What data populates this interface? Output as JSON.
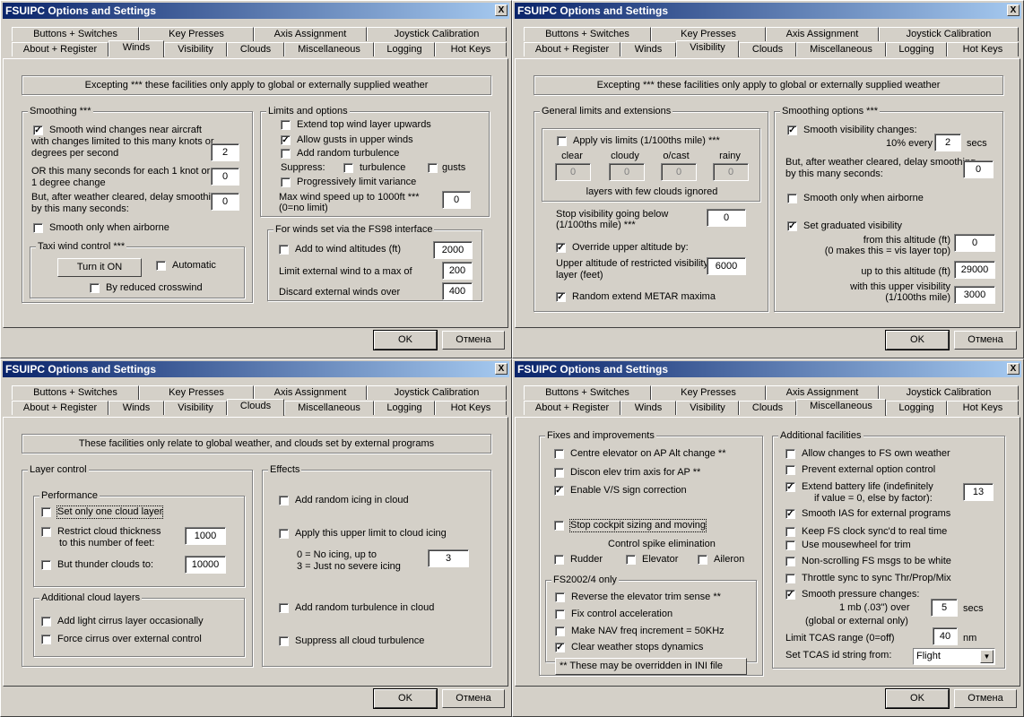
{
  "title": "FSUIPC Options and Settings",
  "close_glyph": "X",
  "tabs": {
    "row1": [
      "Buttons + Switches",
      "Key Presses",
      "Axis Assignment",
      "Joystick Calibration"
    ],
    "row2": [
      "About + Register",
      "Winds",
      "Visibility",
      "Clouds",
      "Miscellaneous",
      "Logging",
      "Hot Keys"
    ]
  },
  "buttons": {
    "ok": "OK",
    "cancel": "Отмена"
  },
  "winds": {
    "banner": "Excepting *** these facilities only apply to global or externally supplied weather",
    "smoothing": {
      "label": "Smoothing ***",
      "smooth_wind_l1": "Smooth wind changes near aircraft",
      "smooth_wind_l2": "with changes limited to this many knots or",
      "smooth_wind_l3": "degrees per second",
      "knots_value": "2",
      "or_seconds_l1": "OR this many seconds for each 1 knot or",
      "or_seconds_l2": "1 degree change",
      "seconds_value": "0",
      "delay_l1": "But, after weather cleared, delay smoothing",
      "delay_l2": "by this many seconds:",
      "delay_value": "0",
      "airborne": "Smooth only when airborne"
    },
    "taxi": {
      "label": "Taxi wind control ***",
      "turn_on": "Turn it ON",
      "automatic": "Automatic",
      "reduced": "By reduced crosswind"
    },
    "limits": {
      "label": "Limits and options",
      "extend_top": "Extend top wind layer upwards",
      "allow_gusts": "Allow gusts in upper winds",
      "add_turb": "Add random turbulence",
      "suppress": "Suppress:",
      "turbulence": "turbulence",
      "gusts": "gusts",
      "prog_limit": "Progressively limit variance",
      "max_speed_l1": "Max wind speed up to 1000ft  ***",
      "max_speed_l2": "(0=no limit)",
      "max_speed_value": "0"
    },
    "fs98": {
      "label": "For winds set via the FS98 interface",
      "add_alt": "Add to wind altitudes (ft)",
      "add_alt_value": "2000",
      "limit_ext": "Limit external wind to a max of",
      "limit_ext_value": "200",
      "discard": "Discard  external winds over",
      "discard_value": "400"
    }
  },
  "visibility": {
    "banner": "Excepting *** these facilities only apply to global or externally supplied weather",
    "general": {
      "label": "General limits and extensions",
      "apply_vis": "Apply vis limits (1/100ths mile)  ***",
      "cols": [
        "clear",
        "cloudy",
        "o/cast",
        "rainy"
      ],
      "values": [
        "0",
        "0",
        "0",
        "0"
      ],
      "few_clouds": "layers with few clouds ignored",
      "stop_l1": "Stop visibility going below",
      "stop_l2": "(1/100ths mile) ***",
      "stop_value": "0",
      "override": "Override upper altitude by:",
      "upper_l1": "Upper altitude of restricted visibility",
      "upper_l2": "layer (feet)",
      "upper_value": "6000",
      "random_metar": "Random extend METAR maxima"
    },
    "smoothing": {
      "label": "Smoothing options ***",
      "smooth_vis": "Smooth visibility changes:",
      "pct_every": "10% every",
      "every_value": "2",
      "secs": "secs",
      "delay_l1": "But, after weather cleared, delay smoothing",
      "delay_l2": "by this many seconds:",
      "delay_value": "0",
      "airborne": "Smooth only when airborne",
      "graduated": "Set graduated visibility",
      "from_l1": "from this altitude (ft)",
      "from_l2": "(0 makes this = vis layer top)",
      "from_value": "0",
      "upto": "up to this altitude (ft)",
      "upto_value": "29000",
      "upper_l1": "with this upper visibility",
      "upper_l2": "(1/100ths mile)",
      "upper_value": "3000"
    }
  },
  "clouds": {
    "banner": "These facilities only relate to global weather, and clouds set by external programs",
    "layer_control": "Layer control",
    "performance": "Performance",
    "one_layer": "Set only one cloud layer",
    "restrict_l1": "Restrict cloud thickness",
    "restrict_l2": "to this number of feet:",
    "restrict_value": "1000",
    "thunder": "But thunder clouds to:",
    "thunder_value": "10000",
    "additional": "Additional cloud layers",
    "cirrus": "Add light cirrus layer occasionally",
    "force_cirrus": "Force cirrus over external control",
    "effects": "Effects",
    "icing": "Add random icing in cloud",
    "upper_icing": "Apply this upper limit to cloud icing",
    "icing_l1": "0 = No icing, up to",
    "icing_l2": "3 = Just no severe icing",
    "icing_value": "3",
    "turb": "Add random turbulence in cloud",
    "suppress_turb": "Suppress all cloud turbulence"
  },
  "misc": {
    "fixes": "Fixes and improvements",
    "centre_elev": "Centre elevator on AP Alt change **",
    "discon": "Discon elev trim axis for AP **",
    "vs_sign": "Enable V/S sign correction",
    "stop_cockpit": "Stop cockpit sizing and moving",
    "spike": "Control spike elimination",
    "rudder": "Rudder",
    "elevator": "Elevator",
    "aileron": "Aileron",
    "fs2002": "FS2002/4 only",
    "reverse_trim": "Reverse the elevator trim sense **",
    "fix_accel": "Fix control acceleration",
    "nav_freq": "Make NAV freq increment = 50KHz",
    "clear_weather": "Clear weather stops dynamics",
    "override_note": "** These may be overridden in INI file",
    "additional": "Additional facilities",
    "allow_changes": "Allow changes to FS own weather",
    "prevent_ext": "Prevent external option control",
    "battery_l1": "Extend battery life (indefinitely",
    "battery_l2": "if value = 0, else by factor):",
    "battery_value": "13",
    "smooth_ias": "Smooth IAS for external programs",
    "keep_clock": "Keep FS clock sync'd to real time",
    "mousewheel": "Use mousewheel for trim",
    "nonscroll": "Non-scrolling FS msgs to be white",
    "throttle": "Throttle sync to sync Thr/Prop/Mix",
    "pressure": "Smooth pressure changes:",
    "mb_over": "1 mb (.03\") over",
    "pressure_value": "5",
    "secs": "secs",
    "global_ext": "(global or external only)",
    "tcas_range": "Limit TCAS range (0=off)",
    "tcas_value": "40",
    "nm": "nm",
    "tcas_id": "Set TCAS id string from:",
    "tcas_select": "Flight"
  }
}
